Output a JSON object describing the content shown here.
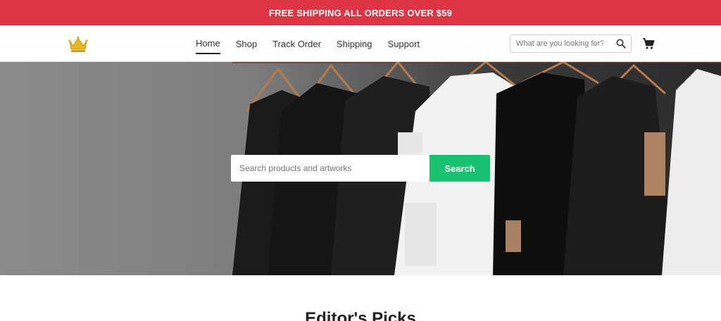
{
  "promo": {
    "text": "FREE SHIPPING ALL ORDERS OVER $59"
  },
  "header": {
    "nav": [
      {
        "label": "Home",
        "active": true
      },
      {
        "label": "Shop",
        "active": false
      },
      {
        "label": "Track Order",
        "active": false
      },
      {
        "label": "Shipping",
        "active": false
      },
      {
        "label": "Support",
        "active": false
      }
    ],
    "search": {
      "placeholder": "What are you looking for?",
      "icon": "search-icon"
    },
    "cart": {
      "icon": "cart-icon"
    },
    "logo": {
      "icon": "crown-logo"
    }
  },
  "hero": {
    "search_placeholder": "Search products and artworks",
    "search_button": "Search",
    "image": "t-shirts-on-hangers"
  },
  "section": {
    "title": "Editor's Picks"
  },
  "colors": {
    "promo_bg": "#dd3545",
    "accent_green": "#19c270"
  }
}
